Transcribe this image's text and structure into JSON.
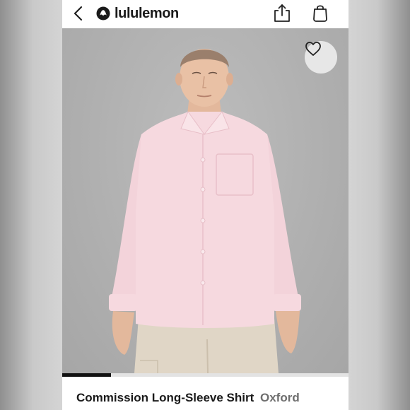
{
  "header": {
    "brand": "lululemon",
    "icons": [
      "back-chevron-icon",
      "lululemon-logo",
      "share-icon",
      "shopping-bag-icon"
    ]
  },
  "gallery": {
    "wishlist_icon": "heart-outline-icon",
    "progress_fraction": 0.17,
    "colors": {
      "background": "#b3b3b3",
      "shirt": "#f6d9df",
      "trousers": "#e0d6c6"
    }
  },
  "product": {
    "name": "Commission Long-Sleeve Shirt",
    "fabric": "Oxford"
  }
}
